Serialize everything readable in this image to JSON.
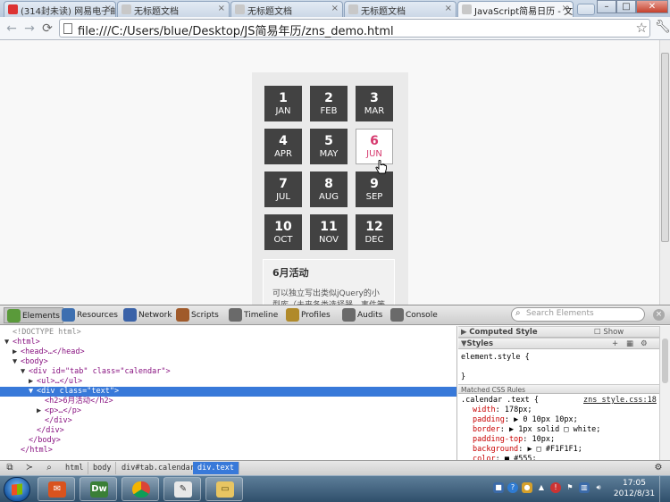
{
  "browser": {
    "tabs": [
      {
        "title": "(314封未读) 网易电子邮",
        "color": "#d33"
      },
      {
        "title": "无标题文档",
        "color": "#c8c8c8"
      },
      {
        "title": "无标题文档",
        "color": "#c8c8c8"
      },
      {
        "title": "无标题文档",
        "color": "#c8c8c8"
      },
      {
        "title": "JavaScript简易日历 - 文",
        "color": "#c8c8c8"
      }
    ],
    "url": "file:///C:/Users/blue/Desktop/JS简易年历/zns_demo.html",
    "window_controls": {
      "minimize": "–",
      "maximize": "□",
      "close": "✕"
    }
  },
  "calendar": {
    "months": [
      {
        "num": "1",
        "abbr": "JAN"
      },
      {
        "num": "2",
        "abbr": "FEB"
      },
      {
        "num": "3",
        "abbr": "MAR"
      },
      {
        "num": "4",
        "abbr": "APR"
      },
      {
        "num": "5",
        "abbr": "MAY"
      },
      {
        "num": "6",
        "abbr": "JUN"
      },
      {
        "num": "7",
        "abbr": "JUL"
      },
      {
        "num": "8",
        "abbr": "AUG"
      },
      {
        "num": "9",
        "abbr": "SEP"
      },
      {
        "num": "10",
        "abbr": "OCT"
      },
      {
        "num": "11",
        "abbr": "NOV"
      },
      {
        "num": "12",
        "abbr": "DEC"
      }
    ],
    "active_index": 5,
    "active_color": "#d6396e",
    "text_title": "6月活动",
    "text_body": "可以独立写出类似jQuery的小型库（未来各类选择器、事件等"
  },
  "devtools": {
    "tabs": [
      "Elements",
      "Resources",
      "Network",
      "Scripts",
      "Timeline",
      "Profiles",
      "Audits",
      "Console"
    ],
    "search_placeholder": "Search Elements",
    "dom_lines": [
      {
        "tri": "",
        "html": "<!DOCTYPE html>"
      },
      {
        "tri": "▼",
        "html": "<html>"
      },
      {
        "tri": "▶",
        "html": "<head>…</head>"
      },
      {
        "tri": "▼",
        "html": "<body>"
      },
      {
        "tri": "▼",
        "html": "<div id=\"tab\" class=\"calendar\">"
      },
      {
        "tri": "▶",
        "html": "<ul>…</ul>"
      },
      {
        "tri": "▼",
        "html": "<div class=\"text\">"
      },
      {
        "tri": "",
        "html": "<h2>6月活动</h2>"
      },
      {
        "tri": "▶",
        "html": "<p>…</p>"
      },
      {
        "tri": "",
        "html": "</div>"
      },
      {
        "tri": "",
        "html": "</div>"
      },
      {
        "tri": "",
        "html": "</body>"
      },
      {
        "tri": "",
        "html": "</html>"
      }
    ],
    "selected_line": 6,
    "computed_style_label": "Computed Style",
    "show_inherited_label": "Show inherited",
    "styles_label": "Styles",
    "element_style": "element.style {",
    "element_style_close": "}",
    "matched_rules_label": "Matched CSS Rules",
    "rule_selector": ".calendar .text {",
    "rule_source": "zns_style.css:18",
    "rule_props": [
      {
        "name": "width",
        "value": "178px;"
      },
      {
        "name": "padding",
        "value": "▶ 0 10px 10px;"
      },
      {
        "name": "border",
        "value": "▶ 1px solid □ white;"
      },
      {
        "name": "padding-top",
        "value": "10px;"
      },
      {
        "name": "background",
        "value": "▶ □ #F1F1F1;"
      },
      {
        "name": "color",
        "value": "■ #555;"
      }
    ],
    "breadcrumbs": [
      "html",
      "body",
      "div#tab.calendar",
      "div.text"
    ],
    "selected_crumb": 3
  },
  "taskbar": {
    "apps": [
      "Outlook",
      "Dw",
      "Chrome",
      "Notepad",
      "Explorer"
    ],
    "time": "17:05",
    "date": "2012/8/31"
  }
}
